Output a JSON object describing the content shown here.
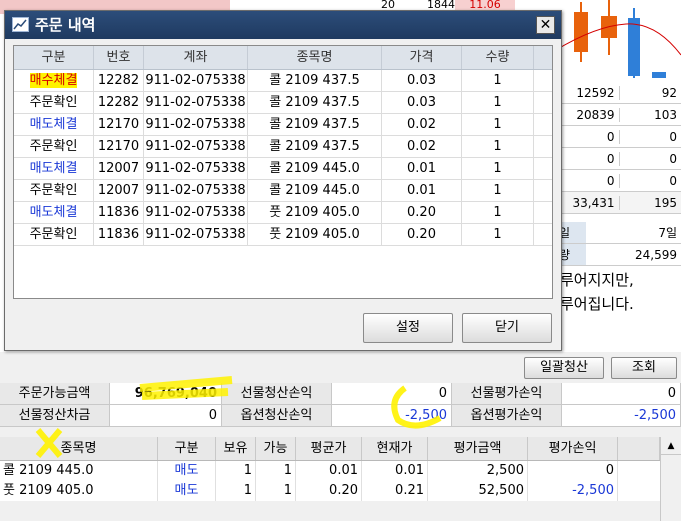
{
  "background": {
    "top_strip": [
      "20",
      "1844",
      "11.06"
    ],
    "grid": [
      [
        "12592",
        "92"
      ],
      [
        "20839",
        "103"
      ],
      [
        "0",
        "0"
      ],
      [
        "0",
        "0"
      ],
      [
        "0",
        "0"
      ],
      [
        "33,431",
        "195"
      ]
    ],
    "info": [
      {
        "label": "일",
        "value": "7일"
      },
      {
        "label": "량",
        "value": "24,599"
      }
    ],
    "note_lines": [
      "루어지지만,",
      "루어집니다."
    ]
  },
  "modal": {
    "title": "주문 내역",
    "columns": [
      "구분",
      "번호",
      "계좌",
      "종목명",
      "가격",
      "수량"
    ],
    "rows": [
      {
        "type": "매수체결",
        "no": "12282",
        "account": "911-02-075338",
        "name": "콜 2109 437.5",
        "price": "0.03",
        "qty": "1"
      },
      {
        "type": "주문확인",
        "no": "12282",
        "account": "911-02-075338",
        "name": "콜 2109 437.5",
        "price": "0.03",
        "qty": "1"
      },
      {
        "type": "매도체결",
        "no": "12170",
        "account": "911-02-075338",
        "name": "콜 2109 437.5",
        "price": "0.02",
        "qty": "1"
      },
      {
        "type": "주문확인",
        "no": "12170",
        "account": "911-02-075338",
        "name": "콜 2109 437.5",
        "price": "0.02",
        "qty": "1"
      },
      {
        "type": "매도체결",
        "no": "12007",
        "account": "911-02-075338",
        "name": "콜 2109 445.0",
        "price": "0.01",
        "qty": "1"
      },
      {
        "type": "주문확인",
        "no": "12007",
        "account": "911-02-075338",
        "name": "콜 2109 445.0",
        "price": "0.01",
        "qty": "1"
      },
      {
        "type": "매도체결",
        "no": "11836",
        "account": "911-02-075338",
        "name": "풋 2109 405.0",
        "price": "0.20",
        "qty": "1"
      },
      {
        "type": "주문확인",
        "no": "11836",
        "account": "911-02-075338",
        "name": "풋 2109 405.0",
        "price": "0.20",
        "qty": "1"
      }
    ],
    "settings_label": "설정",
    "close_label": "닫기"
  },
  "lower": {
    "bulk_settle_label": "일괄청산",
    "query_label": "조회",
    "summary": {
      "order_available_label": "주문가능금액",
      "order_available_value": "96,769,040",
      "futures_settle_pl_label": "선물청산손익",
      "futures_settle_pl_value": "0",
      "futures_eval_pl_label": "선물평가손익",
      "futures_eval_pl_value": "0",
      "futures_diff_label": "선물정산차금",
      "futures_diff_value": "0",
      "option_settle_pl_label": "옵션청산손익",
      "option_settle_pl_value": "-2,500",
      "option_eval_pl_label": "옵션평가손익",
      "option_eval_pl_value": "-2,500"
    },
    "positions": {
      "columns": [
        "종목명",
        "구분",
        "보유",
        "가능",
        "평균가",
        "현재가",
        "평가금액",
        "평가손익"
      ],
      "rows": [
        {
          "name": "콜 2109 445.0",
          "side": "매도",
          "hold": "1",
          "avail": "1",
          "avg": "0.01",
          "cur": "0.01",
          "amount": "2,500",
          "pl": "0"
        },
        {
          "name": "풋 2109 405.0",
          "side": "매도",
          "hold": "1",
          "avail": "1",
          "avg": "0.20",
          "cur": "0.21",
          "amount": "52,500",
          "pl": "-2,500"
        }
      ]
    }
  },
  "colors": {
    "buy": "#d40000",
    "sell": "#1a38d6",
    "title_bar": "#243f68",
    "highlight": "#fff200"
  }
}
